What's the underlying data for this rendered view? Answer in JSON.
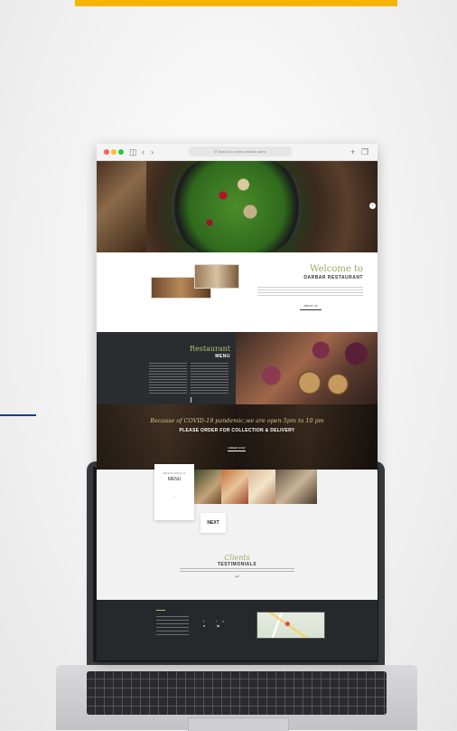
{
  "browser": {
    "url_placeholder": "Search or enter website name",
    "icons": [
      "sidebar-icon",
      "back-chevron-icon",
      "forward-chevron-icon",
      "plus-icon",
      "tabs-icon"
    ]
  },
  "welcome": {
    "title": "Welcome to",
    "subtitle": "DARBAR RESTAURANT",
    "tagline": "",
    "button": "ABOUT US"
  },
  "menu": {
    "title": "Restaurant",
    "subtitle": "MENU"
  },
  "covid": {
    "line1": "Because of COVID-19 pandemic,we are open 5pm to 10 pm",
    "line2": "PLEASE ORDER FOR COLLECTION & DELIVERY",
    "phone": "",
    "button": "ORDER NOW"
  },
  "menu_card": {
    "kicker": "RESTAURANT",
    "title": "MENU",
    "link": "",
    "next": "NEXT"
  },
  "testimonials": {
    "title": "Clients",
    "subtitle": "TESTIMONIALS",
    "mark": "“”",
    "name": ""
  },
  "footer": {
    "social": "f  in  ●  ▶"
  },
  "colors": {
    "accent_yellow": "#f5b400",
    "olive_heading": "#9bab5c",
    "dark_section": "#2a2c30"
  }
}
